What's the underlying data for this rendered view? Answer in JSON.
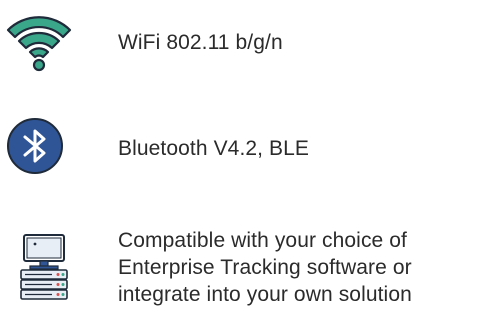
{
  "colors": {
    "wifi_fill": "#3aa68a",
    "wifi_stroke": "#1f2b3a",
    "bluetooth_circle": "#2f5597",
    "server_fill": "#e8eef6",
    "text": "#2b2b2b"
  },
  "features": [
    {
      "icon": "wifi-icon",
      "text": "WiFi 802.11 b/g/n"
    },
    {
      "icon": "bluetooth-icon",
      "text": "Bluetooth V4.2, BLE"
    },
    {
      "icon": "server-computer-icon",
      "lines": [
        "Compatible with your choice of",
        "Enterprise Tracking software or",
        "integrate into your own solution"
      ]
    }
  ]
}
